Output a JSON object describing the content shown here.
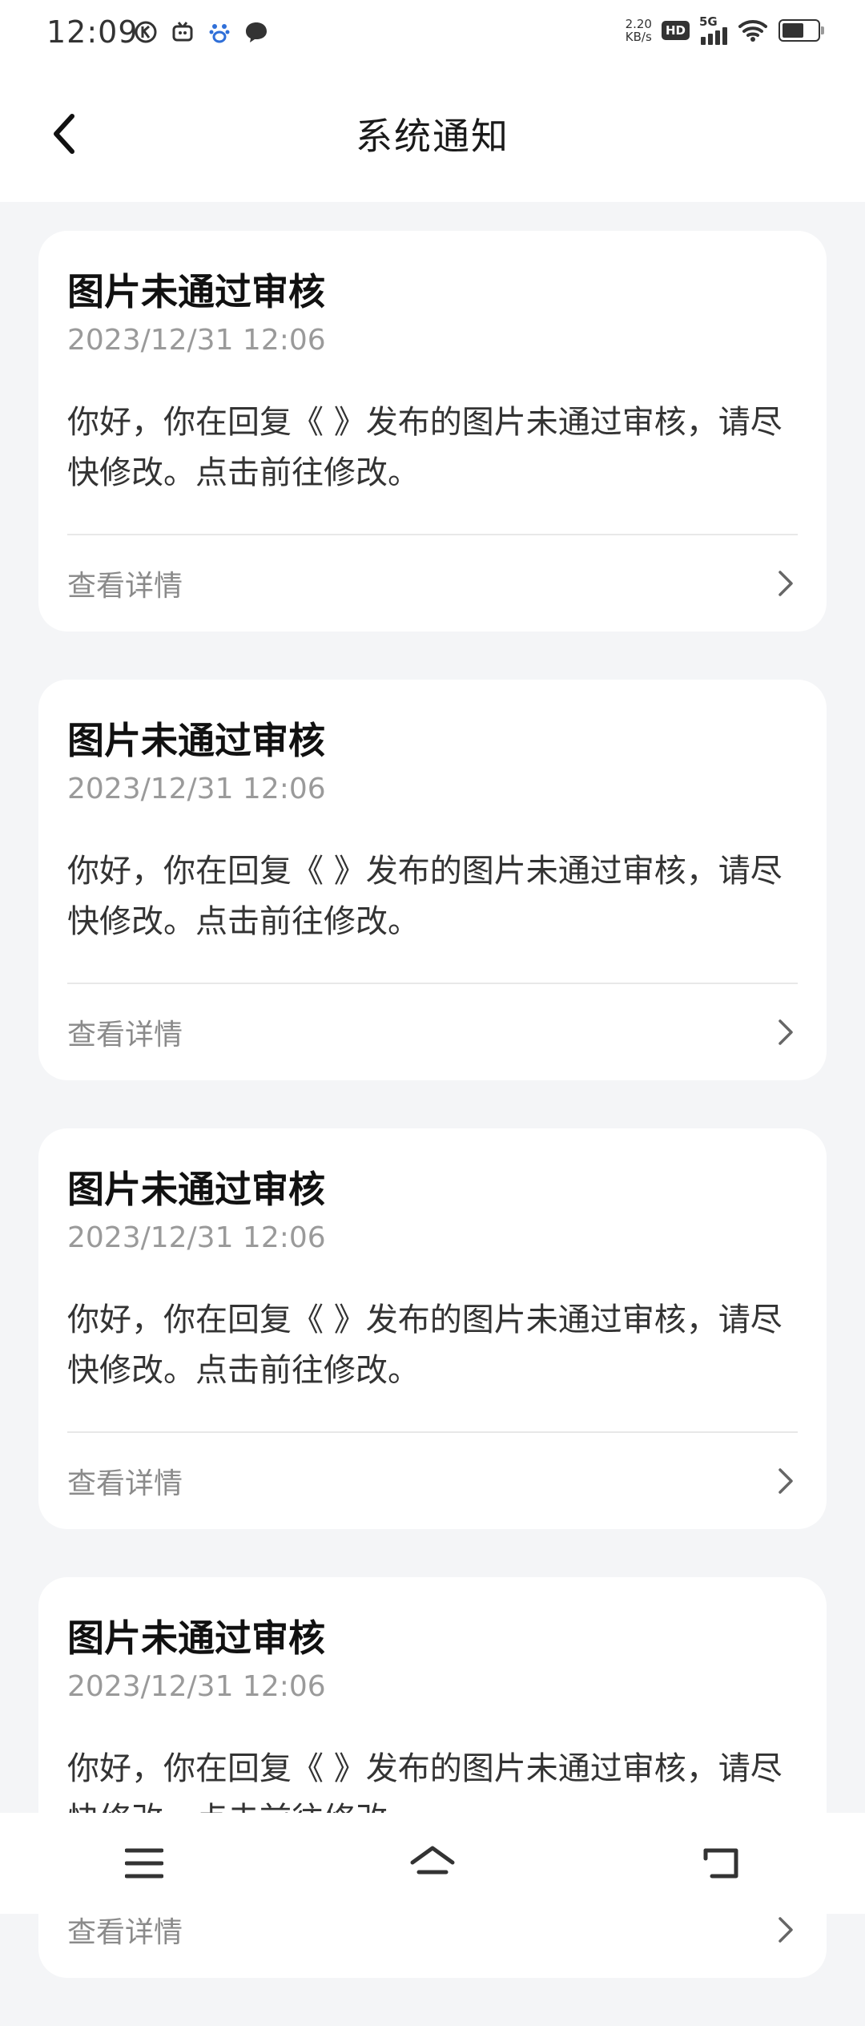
{
  "status_bar": {
    "time": "12:09",
    "net_speed_value": "2.20",
    "net_speed_unit": "KB/s",
    "hd_label": "HD",
    "network_label": "5G",
    "icons": [
      "k-circle-icon",
      "tv-icon",
      "paw-icon",
      "chat-bubble-icon",
      "hd-icon",
      "signal-icon",
      "wifi-icon",
      "battery-icon"
    ]
  },
  "header": {
    "title": "系统通知",
    "back_icon": "chevron-left-icon"
  },
  "notifications": [
    {
      "title": "图片未通过审核",
      "time": "2023/12/31 12:06",
      "body": "你好，你在回复《 》发布的图片未通过审核，请尽快修改。点击前往修改。",
      "detail_label": "查看详情"
    },
    {
      "title": "图片未通过审核",
      "time": "2023/12/31 12:06",
      "body": "你好，你在回复《 》发布的图片未通过审核，请尽快修改。点击前往修改。",
      "detail_label": "查看详情"
    },
    {
      "title": "图片未通过审核",
      "time": "2023/12/31 12:06",
      "body": "你好，你在回复《 》发布的图片未通过审核，请尽快修改。点击前往修改。",
      "detail_label": "查看详情"
    },
    {
      "title": "图片未通过审核",
      "time": "2023/12/31 12:06",
      "body": "你好，你在回复《 》发布的图片未通过审核，请尽快修改。点击前往修改。",
      "detail_label": "查看详情"
    }
  ],
  "nav_bar": {
    "icons": [
      "menu-icon",
      "home-icon",
      "back-icon"
    ]
  },
  "colors": {
    "background": "#f4f5f7",
    "card": "#ffffff",
    "muted_text": "#9a9a9a"
  }
}
